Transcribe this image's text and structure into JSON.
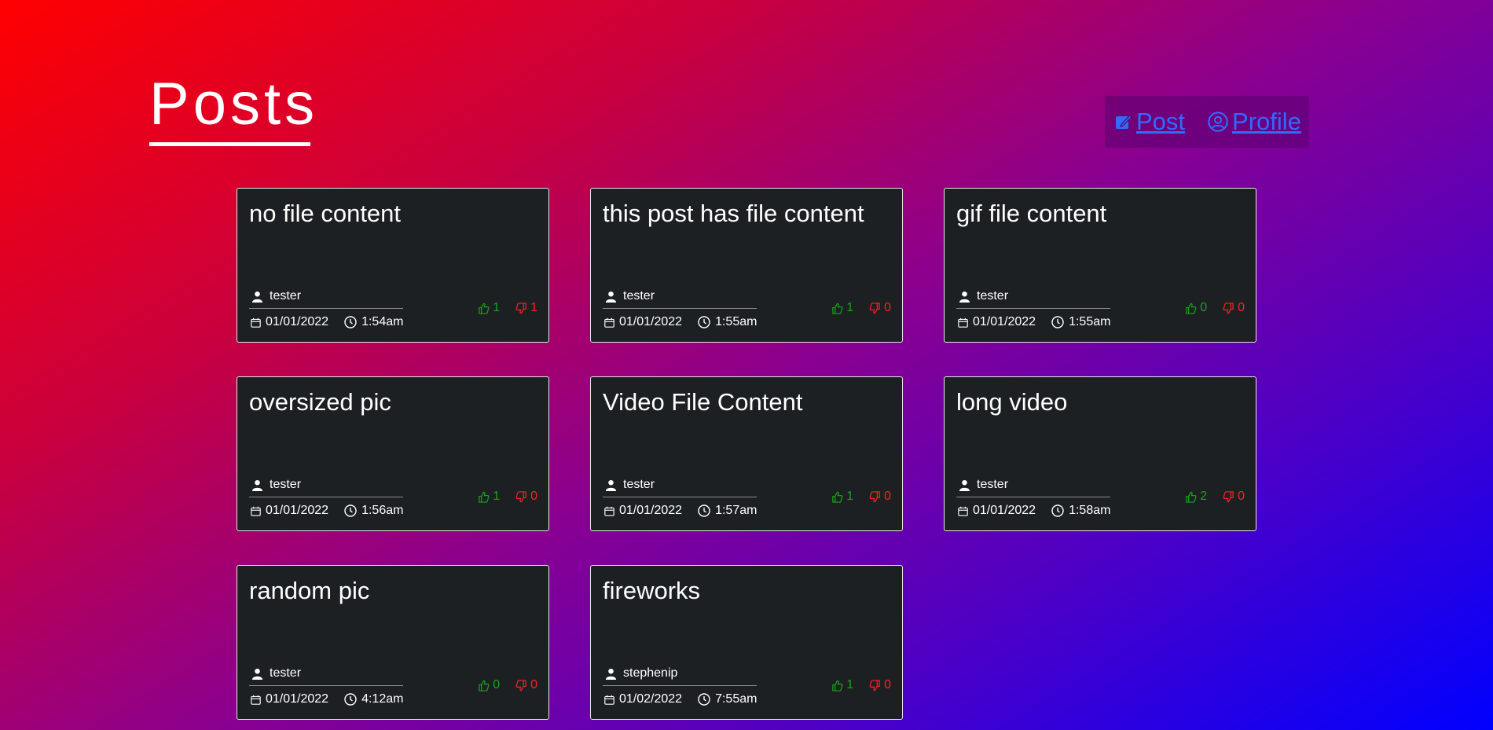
{
  "header": {
    "title": "Posts"
  },
  "nav": {
    "post_label": "Post",
    "profile_label": "Profile"
  },
  "posts": [
    {
      "title": "no file content",
      "author": "tester",
      "date": "01/01/2022",
      "time": "1:54am",
      "likes": "1",
      "dislikes": "1"
    },
    {
      "title": "this post has file content",
      "author": "tester",
      "date": "01/01/2022",
      "time": "1:55am",
      "likes": "1",
      "dislikes": "0"
    },
    {
      "title": "gif file content",
      "author": "tester",
      "date": "01/01/2022",
      "time": "1:55am",
      "likes": "0",
      "dislikes": "0"
    },
    {
      "title": "oversized pic",
      "author": "tester",
      "date": "01/01/2022",
      "time": "1:56am",
      "likes": "1",
      "dislikes": "0"
    },
    {
      "title": "Video File Content",
      "author": "tester",
      "date": "01/01/2022",
      "time": "1:57am",
      "likes": "1",
      "dislikes": "0"
    },
    {
      "title": "long video",
      "author": "tester",
      "date": "01/01/2022",
      "time": "1:58am",
      "likes": "2",
      "dislikes": "0"
    },
    {
      "title": "random pic",
      "author": "tester",
      "date": "01/01/2022",
      "time": "4:12am",
      "likes": "0",
      "dislikes": "0"
    },
    {
      "title": "fireworks",
      "author": "stephenip",
      "date": "01/02/2022",
      "time": "7:55am",
      "likes": "1",
      "dislikes": "0"
    }
  ],
  "colors": {
    "like": "#1aa31a",
    "dislike": "#ff2020",
    "link": "#2f6bff",
    "card_bg": "#1d2023"
  }
}
